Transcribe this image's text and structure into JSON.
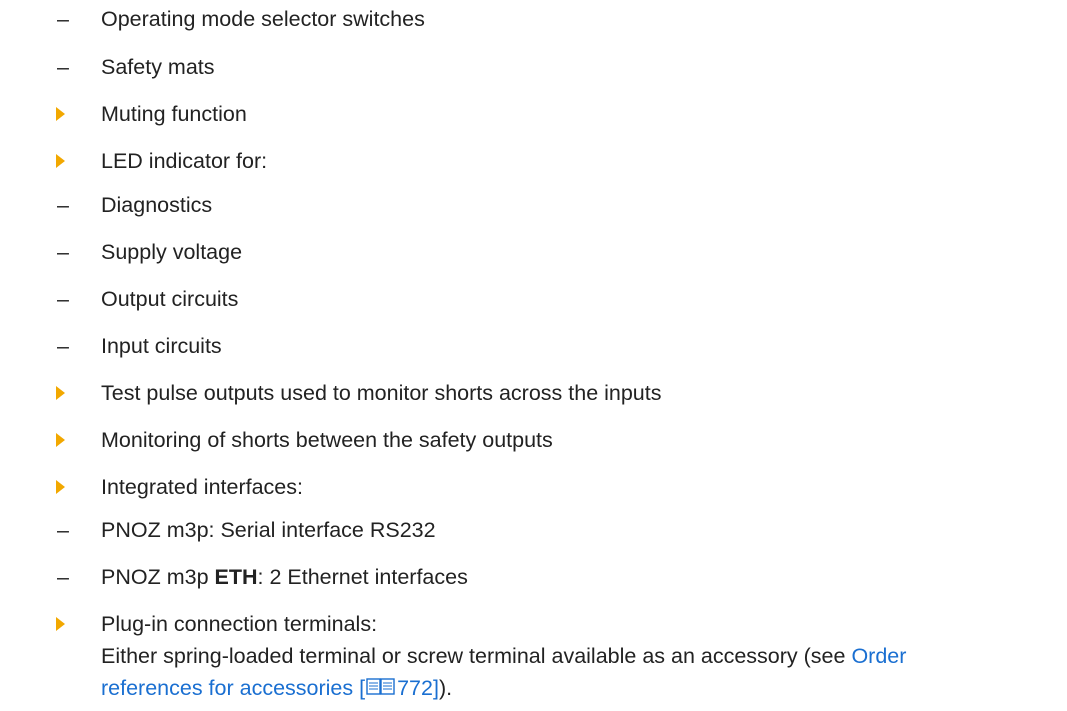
{
  "items": [
    {
      "kind": "dash",
      "text": "Operating mode selector switches"
    },
    {
      "kind": "dash",
      "text": "Safety mats"
    },
    {
      "kind": "bullet",
      "text": "Muting function"
    },
    {
      "kind": "bullet",
      "text": "LED indicator for:"
    },
    {
      "kind": "dash",
      "text": "Diagnostics"
    },
    {
      "kind": "dash",
      "text": "Supply voltage"
    },
    {
      "kind": "dash",
      "text": "Output circuits"
    },
    {
      "kind": "dash",
      "text": "Input circuits"
    },
    {
      "kind": "bullet",
      "text": "Test pulse outputs used to monitor shorts across the inputs"
    },
    {
      "kind": "bullet",
      "text": "Monitoring of shorts between the safety outputs"
    },
    {
      "kind": "bullet",
      "text": "Integrated interfaces:"
    },
    {
      "kind": "dash",
      "text": "PNOZ m3p: Serial interface RS232"
    },
    {
      "kind": "dash",
      "text_pre": "PNOZ m3p ",
      "text_bold": "ETH",
      "text_post": ": 2 Ethernet interfaces"
    },
    {
      "kind": "bullet",
      "text": "Plug-in connection terminals:"
    }
  ],
  "dash_glyph": "–",
  "continuation": {
    "line1_text": "Either spring-loaded terminal or screw terminal available as an accessory (see ",
    "line1_link": "Order",
    "line2_link": "references for accessories [",
    "page_ref": "772]",
    "line2_tail": ")."
  },
  "colors": {
    "bullet": "#f2a800",
    "link": "#1a6fd1",
    "text": "#222222"
  },
  "icons": {
    "bullet": "orange-triangle-bullet-icon",
    "book": "book-icon"
  }
}
